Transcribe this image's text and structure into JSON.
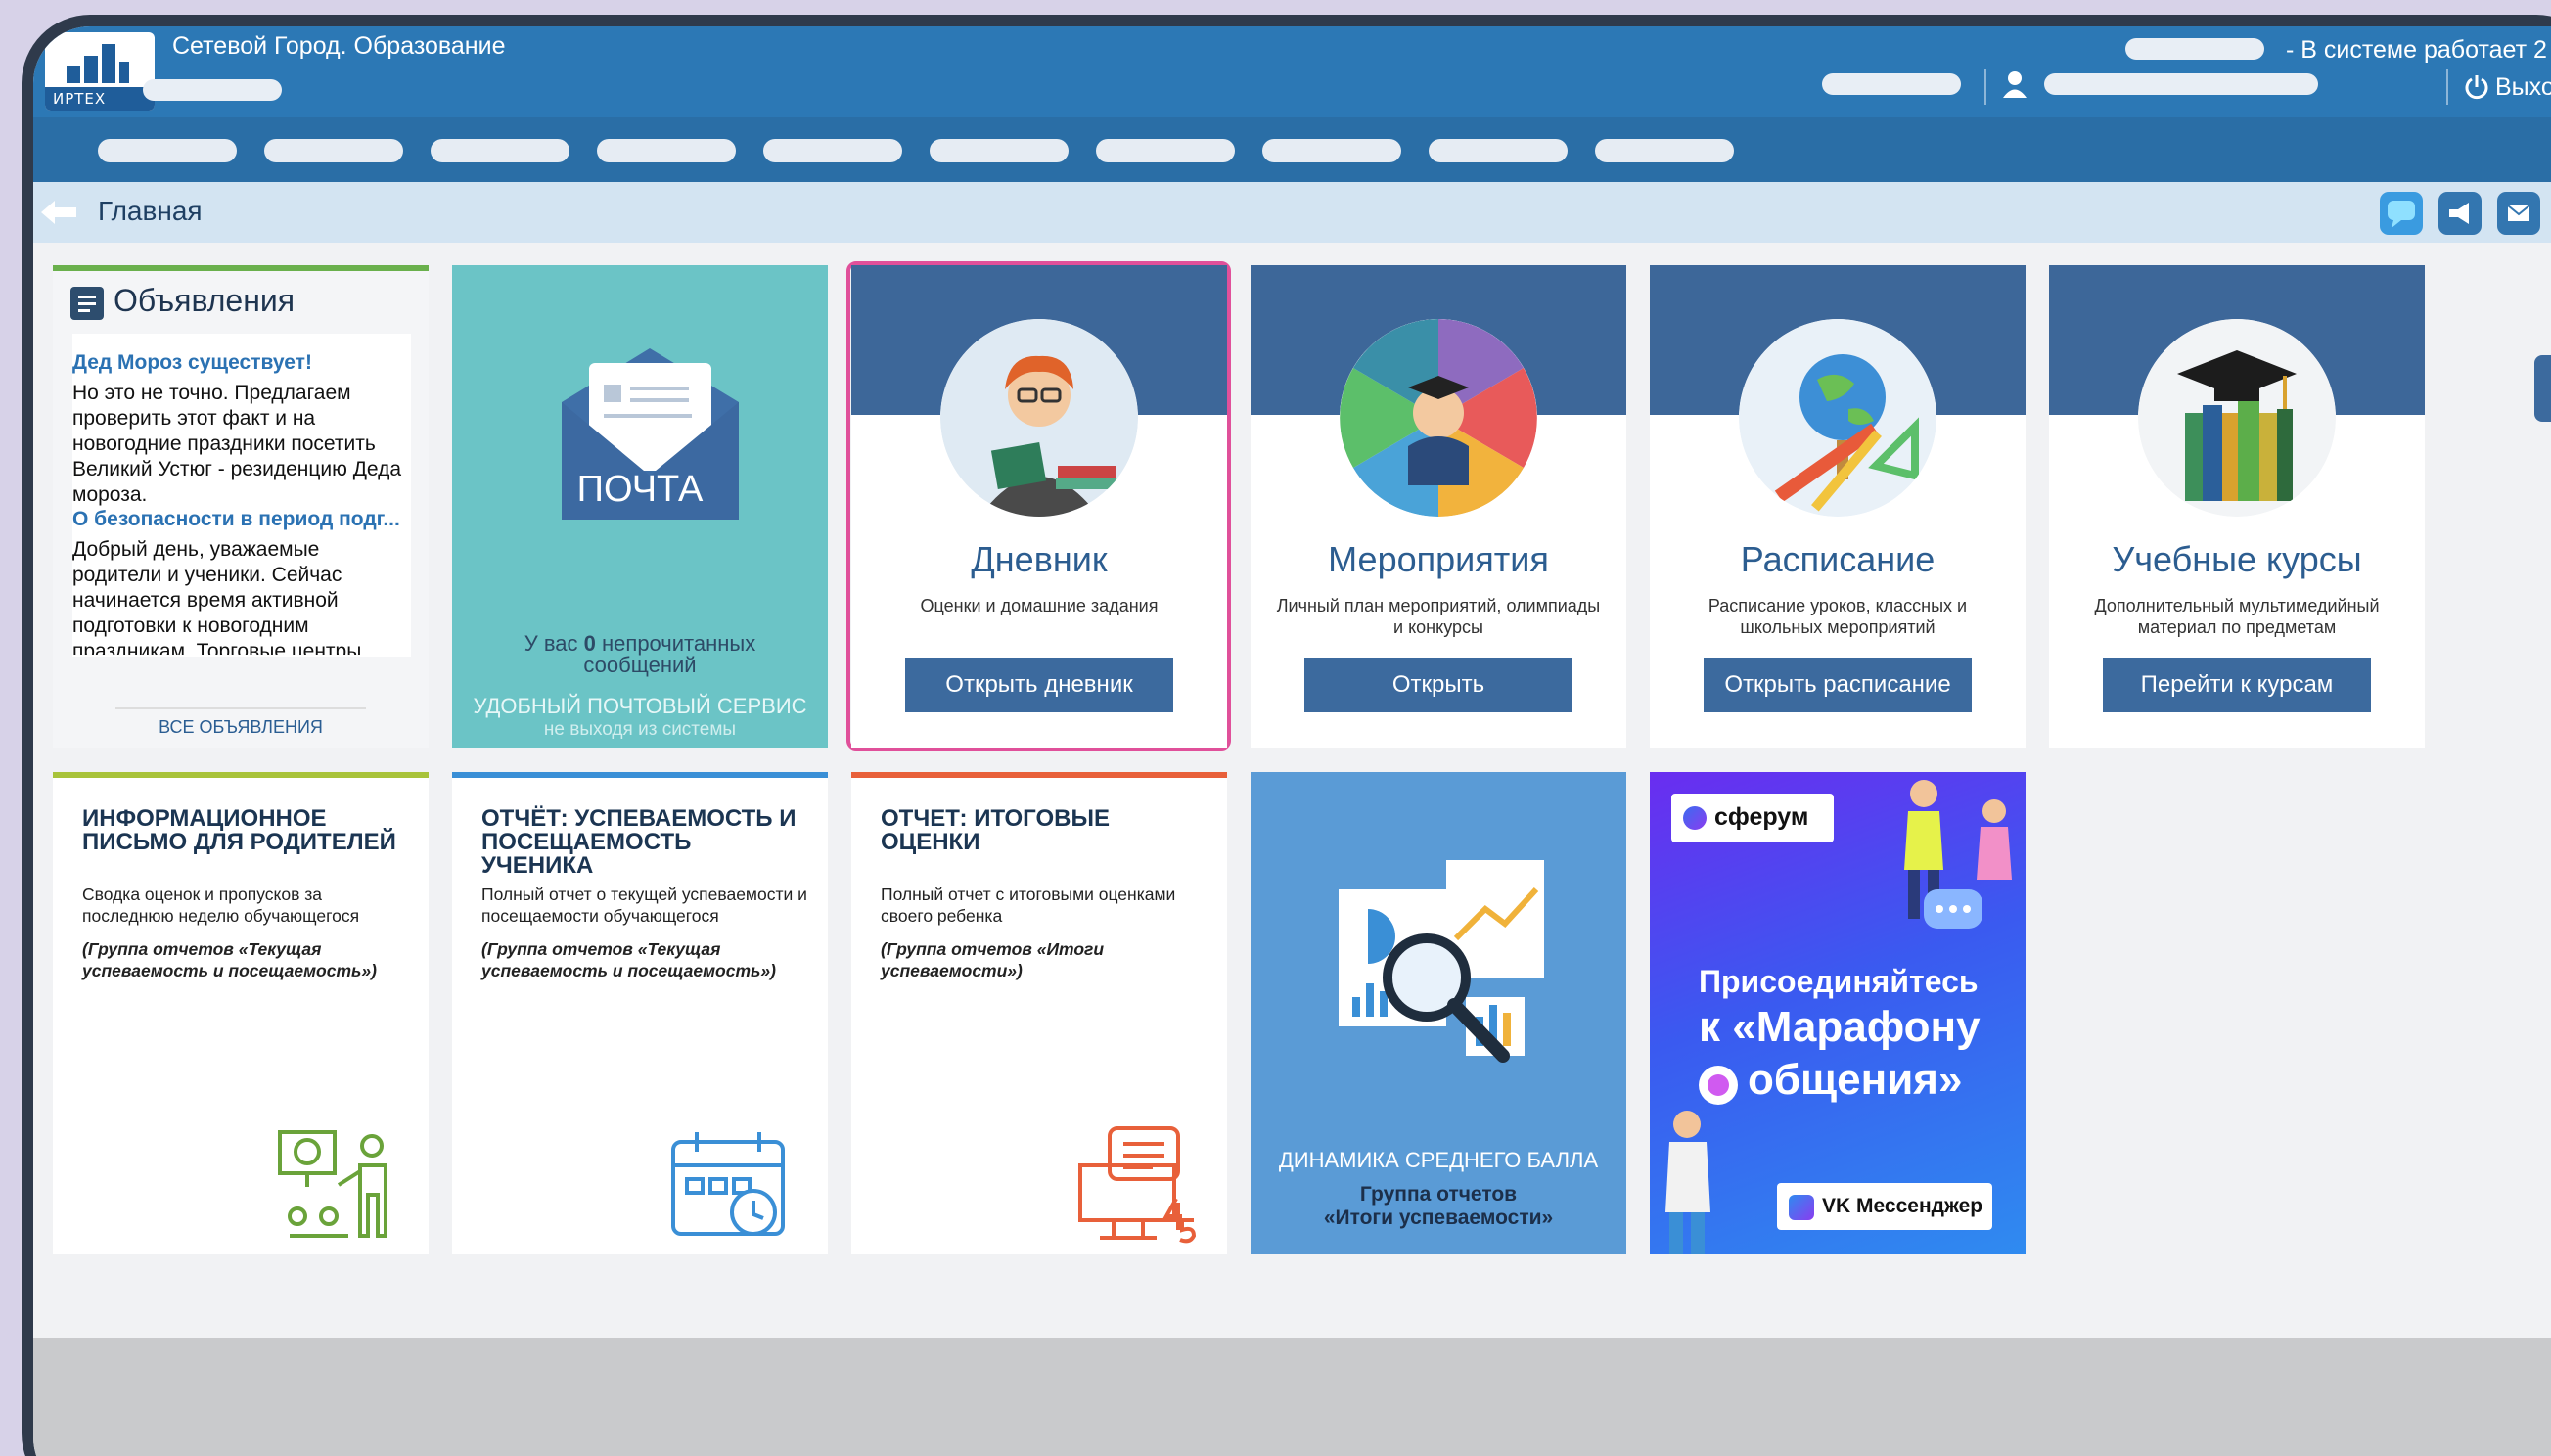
{
  "app": {
    "title": "Сетевой Город. Образование",
    "logo_brand": "ИРТЕХ",
    "users_online": "- В системе работает 2 ",
    "logout": "Выхо"
  },
  "breadcrumb": {
    "title": "Главная"
  },
  "toolbar": {
    "icons": [
      "chat-icon",
      "megaphone-icon",
      "mail-icon"
    ]
  },
  "announcements": {
    "title": "Объявления",
    "items": [
      {
        "head": "Дед Мороз существует!",
        "body": "Но это не точно. Предлагаем проверить этот факт и на новогодние праздники посетить Великий Устюг - резиденцию Деда мороза."
      },
      {
        "head": "О безопасности в период подг...",
        "body": "Добрый день, уважаемые родители и ученики. Сейчас начинается время активной подготовки к новогодним праздникам. Торговые центры"
      }
    ],
    "all_link": "ВСЕ ОБЪЯВЛЕНИЯ"
  },
  "mail": {
    "label": "ПОЧТА",
    "unread_prefix": "У вас ",
    "unread_count": "0",
    "unread_suffix": " непрочитанных",
    "unread_line2": "сообщений",
    "service": "УДОБНЫЙ ПОЧТОВЫЙ СЕРВИС",
    "service_sub": "не выходя из системы"
  },
  "cards": [
    {
      "title": "Дневник",
      "subtitle": "Оценки и домашние задания",
      "button": "Открыть дневник"
    },
    {
      "title": "Мероприятия",
      "subtitle": "Личный план мероприятий, олимпиады и конкурсы",
      "button": "Открыть"
    },
    {
      "title": "Расписание",
      "subtitle": "Расписание уроков, классных и школьных мероприятий",
      "button": "Открыть расписание"
    },
    {
      "title": "Учебные курсы",
      "subtitle": "Дополнительный мультимедийный материал по предметам",
      "button": "Перейти к курсам"
    }
  ],
  "reports": [
    {
      "title": "Информационное письмо для родителей",
      "desc": "Сводка оценок и пропусков за последнюю неделю обучающегося",
      "group": "(Группа отчетов «Текущая успеваемость и посещаемость»)"
    },
    {
      "title": "Отчёт: успеваемость и посещаемость ученика",
      "desc": "Полный отчет о текущей успеваемости и посещаемости обучающегося",
      "group": "(Группа отчетов «Текущая успеваемость и посещаемость»)"
    },
    {
      "title": "Отчет: итоговые оценки",
      "desc": "Полный отчет с итоговыми оценками своего ребенка",
      "group": "(Группа отчетов «Итоги успеваемости»)"
    }
  ],
  "dynamics": {
    "title": "ДИНАМИКА СРЕДНЕГО БАЛЛА",
    "group_line1": "Группа отчетов",
    "group_line2": "«Итоги успеваемости»"
  },
  "banner": {
    "brand": "сферум",
    "line1": "Присоединяйтесь",
    "line2": "к «Марафону",
    "line3": "общения»",
    "messenger": "VK Мессенджер"
  },
  "colors": {
    "header": "#2c78b5",
    "nav": "#2a6ea6",
    "card_top": "#3d6799",
    "button": "#3c6a9e",
    "highlight": "#e0509a",
    "mail_bg": "#6bc4c6",
    "dynamics_bg": "#5a9bd6",
    "banner_bg": "#3a5af0"
  }
}
